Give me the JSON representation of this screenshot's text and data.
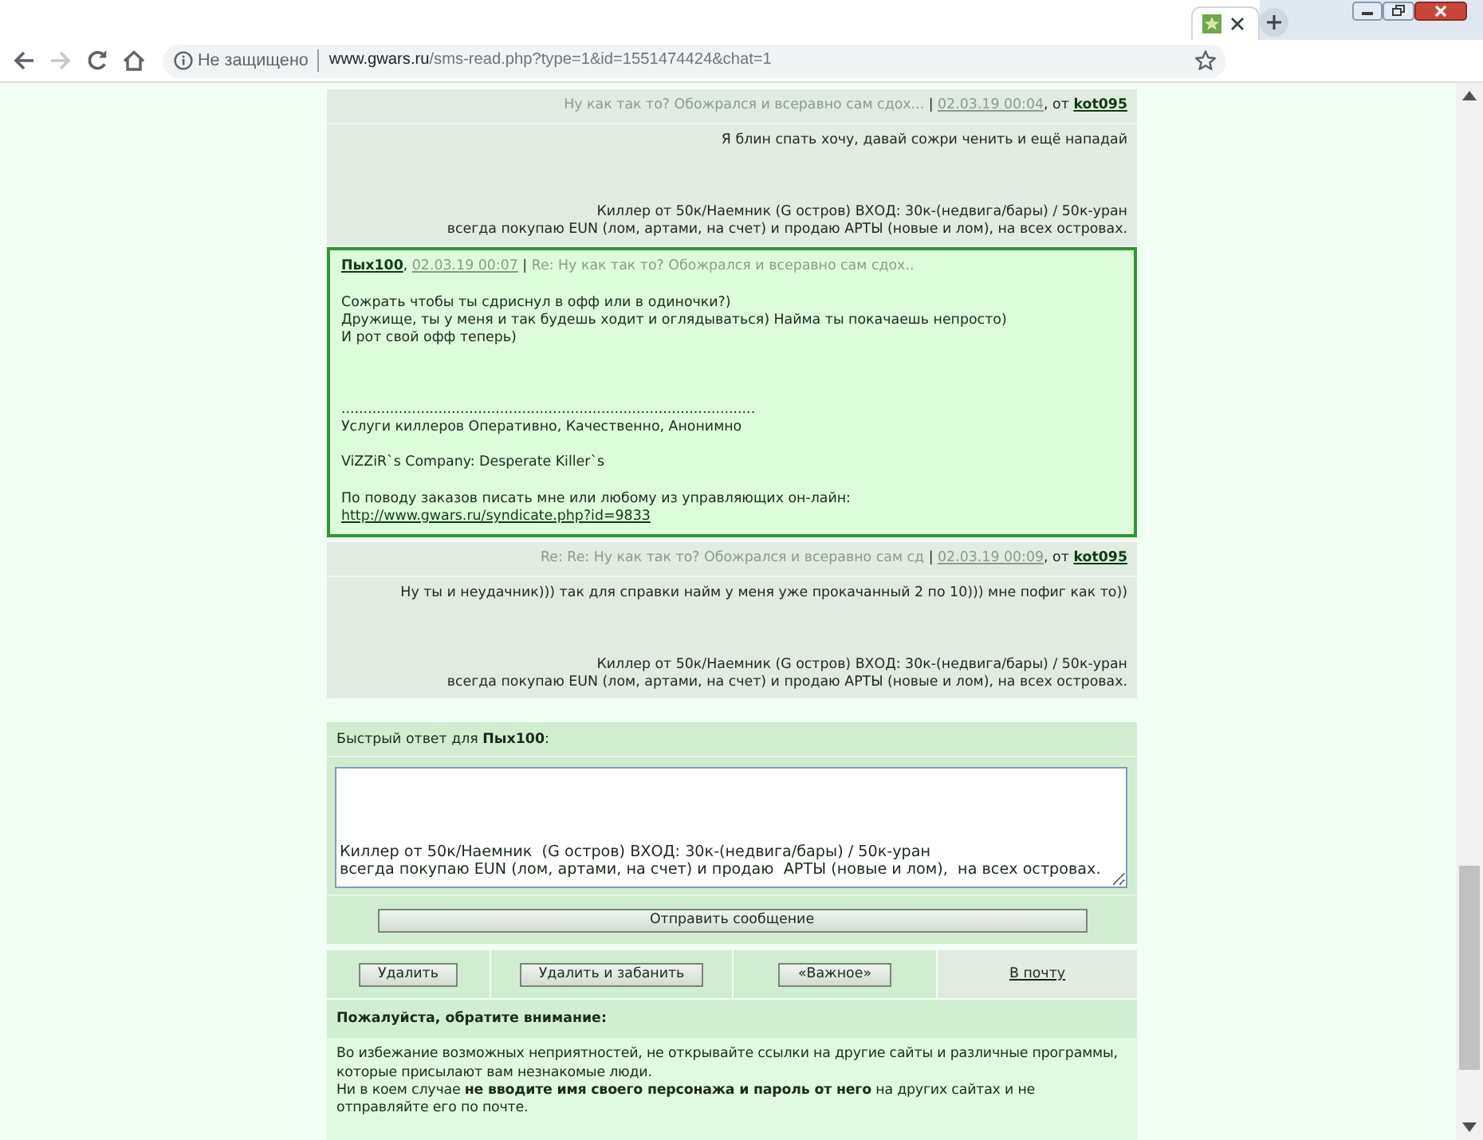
{
  "browser": {
    "nav_buttons": [
      {
        "kind": "back",
        "disabled": false
      },
      {
        "kind": "forward",
        "disabled": true
      },
      {
        "kind": "reload",
        "disabled": false
      },
      {
        "kind": "home",
        "disabled": false
      }
    ],
    "security_label": "Не защищено",
    "url_host": "www.gwars.ru",
    "url_path": "/sms-read.php?type=1&id=1551474424&chat=1"
  },
  "messages": [
    {
      "highlighted": false,
      "header": [
        {
          "kind": "subject",
          "text": "Ну как так то? Обожрался и всеравно сам сдох..."
        },
        {
          "kind": "plain",
          "text": " | "
        },
        {
          "kind": "date",
          "text": "02.03.19 00:04"
        },
        {
          "kind": "plain",
          "text": ", от "
        },
        {
          "kind": "author",
          "text": "kot095"
        }
      ],
      "text": "Я блин спать хочу, давай сожри ченить и ещё нападай",
      "signature": [
        "Киллер от 50к/Наемник (G остров) ВХОД: 30к-(недвига/бары) / 50к-уран\nвсегда покупаю EUN (лом, артами, на счет) и продаю АРТЫ (новые и лом), на всех островах."
      ]
    },
    {
      "highlighted": true,
      "header": [
        {
          "kind": "author",
          "text": "Пых100"
        },
        {
          "kind": "plain",
          "text": ", "
        },
        {
          "kind": "date",
          "text": "02.03.19 00:07"
        },
        {
          "kind": "plain",
          "text": " | "
        },
        {
          "kind": "subject",
          "text": "Re: Ну как так то? Обожрался и всеравно сам сдох.."
        }
      ],
      "text": "Сожрать чтобы ты сдриснул в офф или в одиночки?)\nДружище, ты у меня и так будешь ходит и оглядываться) Найма ты покачаешь непросто)\nИ рот свой офф теперь)",
      "signature": [
        "..............................................................................................\nУслуги киллеров Оперативно, Качественно, Анонимно",
        "ViZZiR`s Company: Desperate Killer`s",
        "По поводу заказов писать мне или любому из управляющих он-лайн:"
      ],
      "signature_link": "http://www.gwars.ru/syndicate.php?id=9833"
    },
    {
      "highlighted": false,
      "header": [
        {
          "kind": "subject",
          "text": "Re: Re: Ну как так то? Обожрался и всеравно сам сд"
        },
        {
          "kind": "plain",
          "text": " | "
        },
        {
          "kind": "date",
          "text": "02.03.19 00:09"
        },
        {
          "kind": "plain",
          "text": ", от "
        },
        {
          "kind": "author",
          "text": "kot095"
        }
      ],
      "text": "Ну ты и неудачник))) так для справки найм у меня уже прокачанный 2 по 10))) мне пофиг как то))",
      "signature": [
        "Киллер от 50к/Наемник (G остров) ВХОД: 30к-(недвига/бары) / 50к-уран\nвсегда покупаю EUN (лом, артами, на счет) и продаю АРТЫ (новые и лом), на всех островах."
      ]
    }
  ],
  "quick_reply": {
    "label": "Быстрый ответ для **Пых100**:",
    "value": "\n\n\n\nКиллер от 50к/Наемник  (G остров) ВХОД: 30к-(недвига/бары) / 50к-уран\nвсегда покупаю EUN (лом, артами, на счет) и продаю  АРТЫ (новые и лом),  на всех островах.",
    "send_button": "Отправить сообщение"
  },
  "actions": [
    {
      "kind": "button",
      "label": "Удалить"
    },
    {
      "kind": "button",
      "label": "Удалить и забанить"
    },
    {
      "kind": "button",
      "label": "«Важное»"
    },
    {
      "kind": "link",
      "label": "В почту"
    }
  ],
  "notice": {
    "title": "Пожалуйста, обратите внимание:",
    "text": "Во избежание возможных неприятностей, не открывайте ссылки на другие сайты и различные программы, которые присылают вам незнакомые люди.\nНи в коем случае **не вводите имя своего персонажа и пароль от него** на других сайтах и не отправляйте его по почте."
  }
}
